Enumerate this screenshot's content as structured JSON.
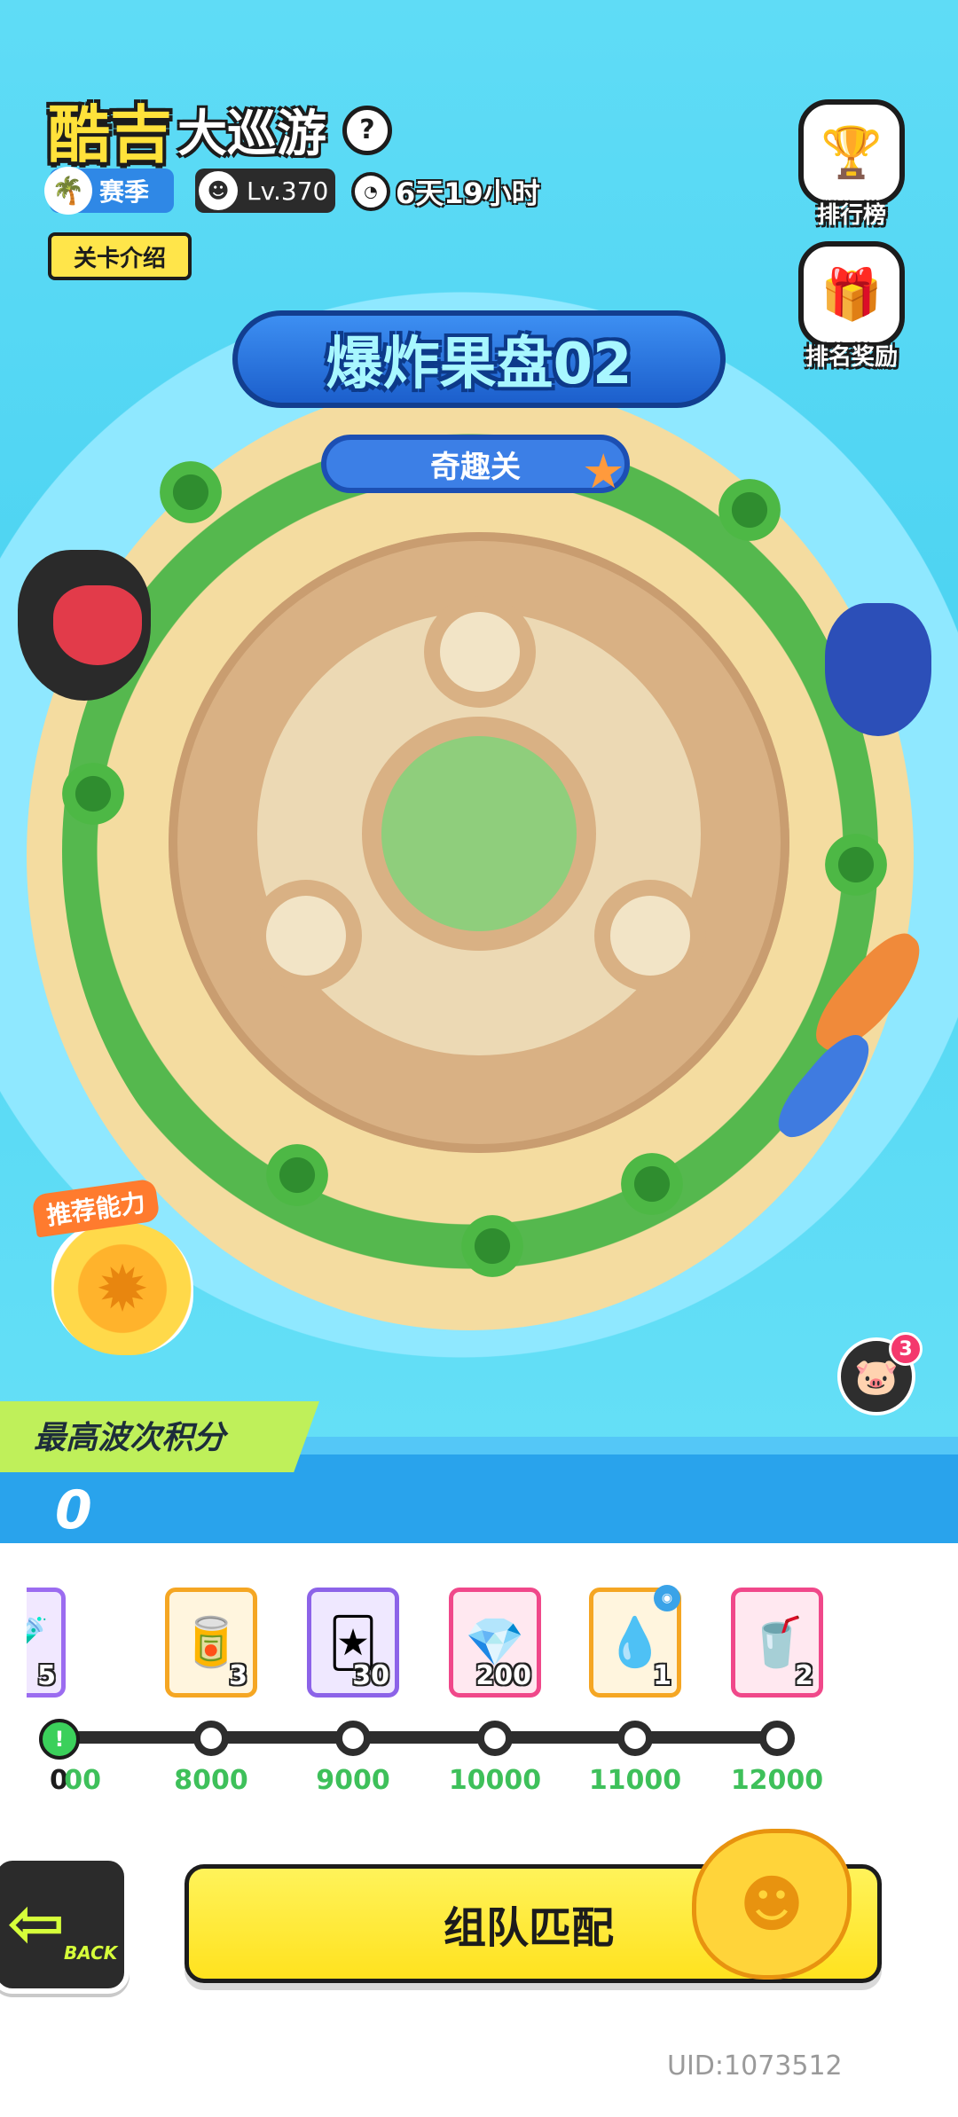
{
  "header": {
    "title_part1": "酷吉",
    "title_part2": "大巡游",
    "help_icon": "question-icon",
    "season_label": "赛季",
    "level_label": "Lv.370",
    "timer_text": "6天19小时",
    "intro_button": "关卡介绍"
  },
  "side_buttons": {
    "leaderboard": "排行榜",
    "rank_reward": "排名奖励"
  },
  "stage": {
    "title": "爆炸果盘02",
    "subtitle": "奇趣关"
  },
  "recommend_label": "推荐能力",
  "mail_badge": "3",
  "score": {
    "label": "最高波次积分",
    "value": "0"
  },
  "rewards": [
    {
      "count": "5",
      "icon": "potion-icon",
      "color": "#9b6cf0"
    },
    {
      "count": "3",
      "icon": "cola-can-icon",
      "color": "#f5a623"
    },
    {
      "count": "30",
      "icon": "card-pack-icon",
      "color": "#8c63e8"
    },
    {
      "count": "200",
      "icon": "diamond-icon",
      "color": "#f0488a"
    },
    {
      "count": "1",
      "icon": "water-drop-icon",
      "color": "#f5a623"
    },
    {
      "count": "2",
      "icon": "gift-can-icon",
      "color": "#f0488a"
    }
  ],
  "milestones": {
    "start": "0",
    "partial": "00",
    "m1": "8000",
    "m2": "9000",
    "m3": "10000",
    "m4": "11000",
    "m5": "12000"
  },
  "bottom": {
    "back_label": "BACK",
    "match_button": "组队匹配",
    "uid": "UID:1073512"
  }
}
